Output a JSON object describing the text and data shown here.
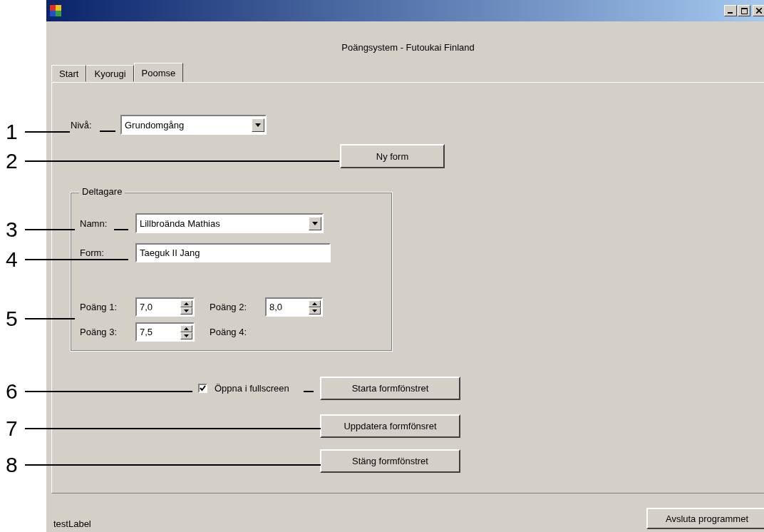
{
  "header_label": "Poängsystem - Futoukai Finland",
  "tabs": [
    {
      "label": "Start",
      "selected": false
    },
    {
      "label": "Kyorugi",
      "selected": false
    },
    {
      "label": "Poomse",
      "selected": true
    }
  ],
  "level": {
    "label": "Nivå:",
    "value": "Grundomgång"
  },
  "new_form_button": "Ny form",
  "participant_group": {
    "title": "Deltagare",
    "name": {
      "label": "Namn:",
      "value": "Lillbroända Mathias"
    },
    "form": {
      "label": "Form:",
      "value": "Taeguk II Jang"
    },
    "scores": [
      {
        "label": "Poäng 1:",
        "value": "7,0"
      },
      {
        "label": "Poäng 2:",
        "value": "8,0"
      },
      {
        "label": "Poäng 3:",
        "value": "7,5"
      },
      {
        "label": "Poäng 4:"
      }
    ]
  },
  "fullscreen": {
    "label": "Öppna i fullscreen",
    "checked": true
  },
  "buttons": [
    "Starta formfönstret",
    "Uppdatera formfönsret",
    "Stäng formfönstret"
  ],
  "status_label": "testLabel",
  "exit_button": "Avsluta programmet",
  "callouts": [
    "1",
    "2",
    "3",
    "4",
    "5",
    "6",
    "7",
    "8"
  ]
}
